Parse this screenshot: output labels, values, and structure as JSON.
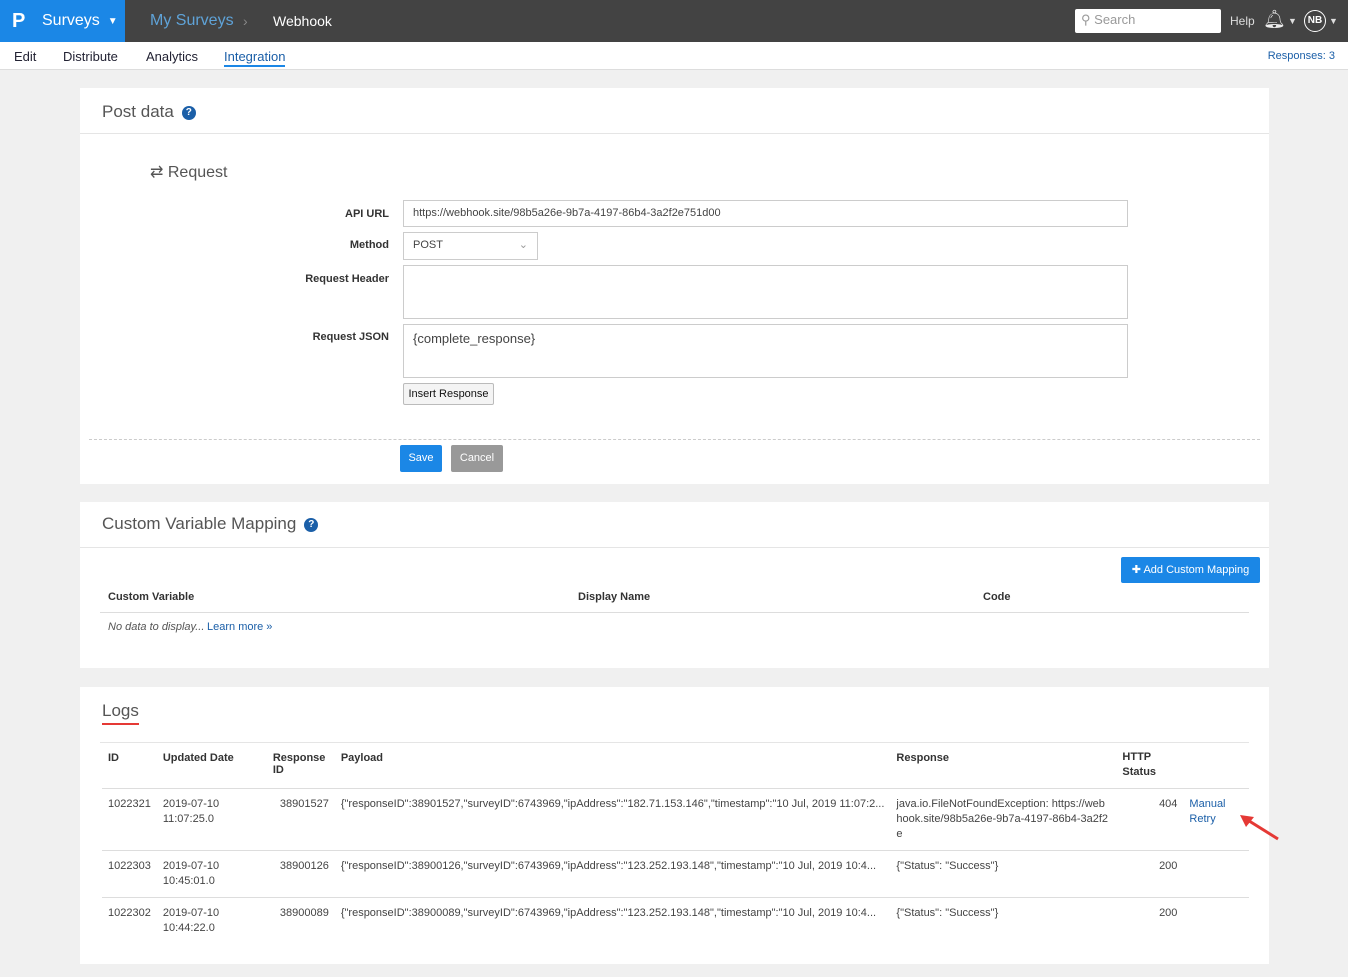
{
  "topbar": {
    "logo": "P",
    "app": "Surveys",
    "breadcrumb": [
      "My Surveys",
      "Webhook"
    ],
    "search_placeholder": "Search",
    "help": "Help",
    "avatar": "NB"
  },
  "subnav": {
    "tabs": [
      "Edit",
      "Distribute",
      "Analytics",
      "Integration"
    ],
    "active": "Integration",
    "responses": "Responses: 3"
  },
  "post": {
    "title": "Post data",
    "section": "Request",
    "api_url_label": "API URL",
    "api_url": "https://webhook.site/98b5a26e-9b7a-4197-86b4-3a2f2e751d00",
    "method_label": "Method",
    "method": "POST",
    "header_label": "Request Header",
    "header": "",
    "json_label": "Request JSON",
    "json": "{complete_response}",
    "insert": "Insert Response",
    "save": "Save",
    "cancel": "Cancel"
  },
  "mapping": {
    "title": "Custom Variable Mapping",
    "add": "Add Custom Mapping",
    "columns": [
      "Custom Variable",
      "Display Name",
      "Code"
    ],
    "empty": "No data to display...",
    "learn": "Learn more »"
  },
  "logs": {
    "title": "Logs",
    "columns": [
      "ID",
      "Updated Date",
      "Response ID",
      "Payload",
      "Response",
      "HTTP Status",
      ""
    ],
    "rows": [
      {
        "id": "1022321",
        "date": "2019-07-10 11:07:25.0",
        "rid": "38901527",
        "payload": "{\"responseID\":38901527,\"surveyID\":6743969,\"ipAddress\":\"182.71.153.146\",\"timestamp\":\"10 Jul, 2019 11:07:2...",
        "response": "java.io.FileNotFoundException: https://webhook.site/98b5a26e-9b7a-4197-86b4-3a2f2e",
        "status": "404",
        "action": "Manual Retry"
      },
      {
        "id": "1022303",
        "date": "2019-07-10 10:45:01.0",
        "rid": "38900126",
        "payload": "{\"responseID\":38900126,\"surveyID\":6743969,\"ipAddress\":\"123.252.193.148\",\"timestamp\":\"10 Jul, 2019 10:4...",
        "response": "{\"Status\": \"Success\"}",
        "status": "200",
        "action": ""
      },
      {
        "id": "1022302",
        "date": "2019-07-10 10:44:22.0",
        "rid": "38900089",
        "payload": "{\"responseID\":38900089,\"surveyID\":6743969,\"ipAddress\":\"123.252.193.148\",\"timestamp\":\"10 Jul, 2019 10:4...",
        "response": "{\"Status\": \"Success\"}",
        "status": "200",
        "action": ""
      }
    ]
  }
}
